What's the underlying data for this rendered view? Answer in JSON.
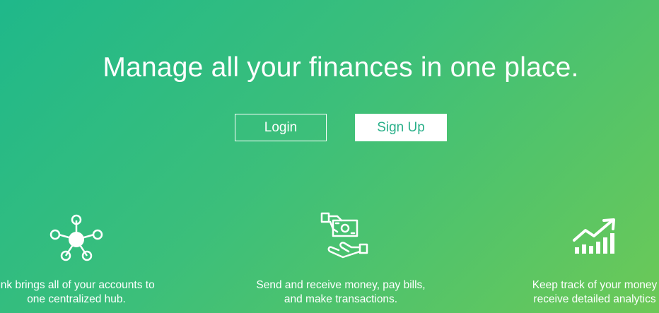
{
  "hero": {
    "headline": "Manage all your finances in one place.",
    "login_label": "Login",
    "signup_label": "Sign Up"
  },
  "features": [
    {
      "icon": "hub-network-icon",
      "line1": "ink brings all of your accounts to",
      "line2": "one centralized hub."
    },
    {
      "icon": "money-transfer-hand-icon",
      "line1": "Send and receive money, pay bills,",
      "line2": "and make transactions."
    },
    {
      "icon": "growth-chart-icon",
      "line1": "Keep track of your money",
      "line2": "receive detailed analytics"
    }
  ],
  "colors": {
    "gradient_start": "#1fb88a",
    "gradient_end": "#6cc957",
    "signup_text": "#2bb08a"
  }
}
